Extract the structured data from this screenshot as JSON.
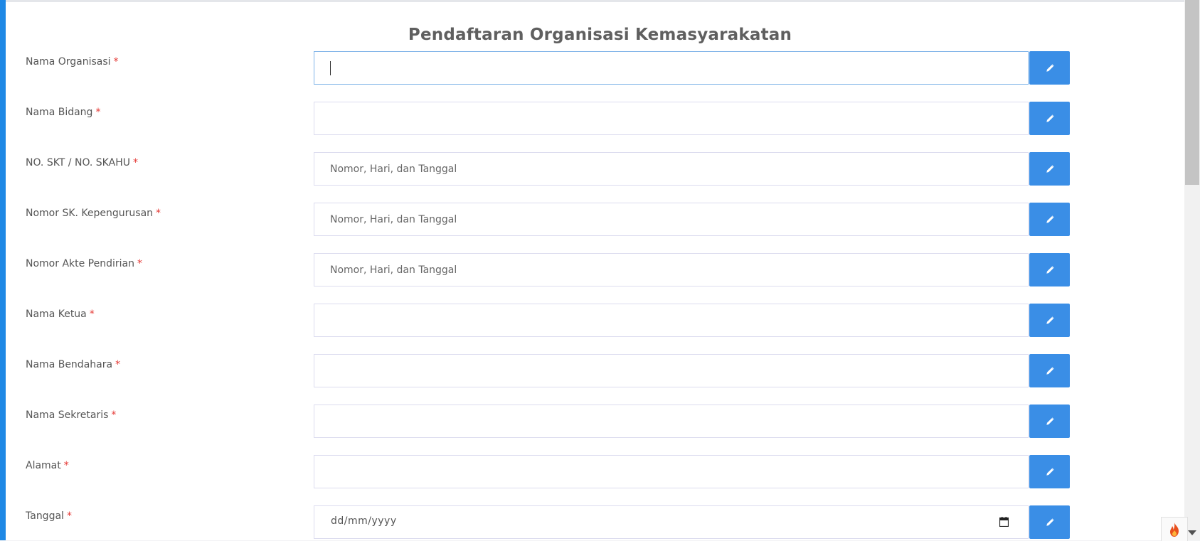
{
  "form": {
    "title": "Pendaftaran Organisasi Kemasyarakatan",
    "required_mark": "*",
    "fields": [
      {
        "label": "Nama Organisasi",
        "value": "",
        "placeholder": ""
      },
      {
        "label": "Nama Bidang",
        "value": "",
        "placeholder": ""
      },
      {
        "label": "NO. SKT / NO. SKAHU",
        "value": "",
        "placeholder": "Nomor, Hari, dan Tanggal"
      },
      {
        "label": "Nomor SK. Kepengurusan",
        "value": "",
        "placeholder": "Nomor, Hari, dan Tanggal"
      },
      {
        "label": "Nomor Akte Pendirian",
        "value": "",
        "placeholder": "Nomor, Hari, dan Tanggal"
      },
      {
        "label": "Nama Ketua",
        "value": "",
        "placeholder": ""
      },
      {
        "label": "Nama Bendahara",
        "value": "",
        "placeholder": ""
      },
      {
        "label": "Nama Sekretaris",
        "value": "",
        "placeholder": ""
      },
      {
        "label": "Alamat",
        "value": "",
        "placeholder": ""
      },
      {
        "label": "Tanggal",
        "value": "",
        "placeholder": "dd/mm/yyyy"
      }
    ],
    "edit_icon": "pencil-icon",
    "calendar_icon": "calendar-icon"
  },
  "colors": {
    "accent": "#3a8ee6",
    "left_bar": "#1e88e5",
    "required": "#e53935"
  }
}
